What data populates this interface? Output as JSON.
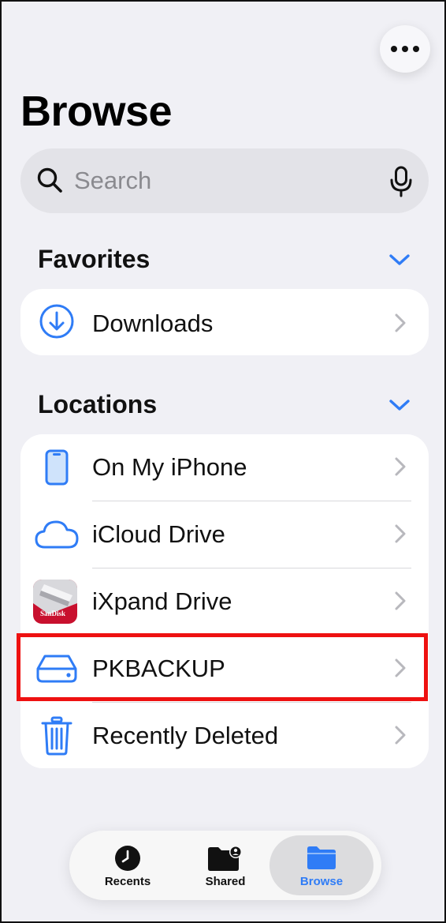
{
  "header": {
    "title": "Browse"
  },
  "search": {
    "placeholder": "Search"
  },
  "favorites": {
    "title": "Favorites",
    "items": [
      {
        "label": "Downloads",
        "icon": "download-icon"
      }
    ]
  },
  "locations": {
    "title": "Locations",
    "items": [
      {
        "label": "On My iPhone",
        "icon": "iphone-icon"
      },
      {
        "label": "iCloud Drive",
        "icon": "cloud-icon"
      },
      {
        "label": "iXpand Drive",
        "icon": "sandisk-icon"
      },
      {
        "label": "PKBACKUP",
        "icon": "external-drive-icon",
        "highlighted": true
      },
      {
        "label": "Recently Deleted",
        "icon": "trash-icon"
      }
    ]
  },
  "sandisk_logo_text": "SanDisk",
  "tabbar": {
    "tabs": [
      {
        "label": "Recents",
        "icon": "clock-icon",
        "active": false
      },
      {
        "label": "Shared",
        "icon": "shared-folder-icon",
        "active": false
      },
      {
        "label": "Browse",
        "icon": "folder-icon",
        "active": true
      }
    ]
  },
  "colors": {
    "accent": "#2f7cf6",
    "highlight": "#ee1111",
    "background": "#f0f0f5"
  }
}
